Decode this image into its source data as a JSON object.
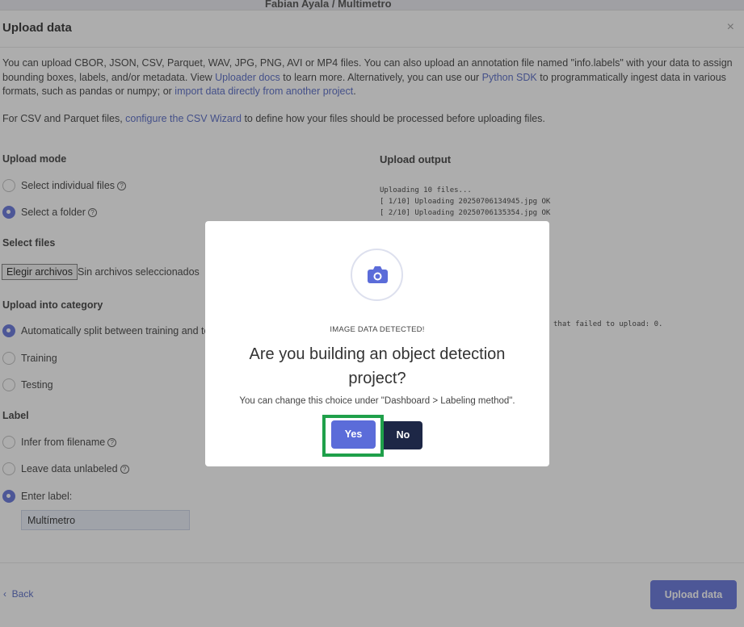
{
  "background_header": {
    "breadcrumb": "Fabian Ayala / Multimetro"
  },
  "dialog": {
    "title": "Upload data",
    "close_glyph": "×",
    "intro": {
      "part1": "You can upload CBOR, JSON, CSV, Parquet, WAV, JPG, PNG, AVI or MP4 files. You can also upload an annotation file named \"info.labels\" with your data to assign bounding boxes, labels, and/or metadata. View ",
      "link1": "Uploader docs",
      "part2": " to learn more. Alternatively, you can use our ",
      "link2": "Python SDK",
      "part3": " to programmatically ingest data in various formats, such as pandas or numpy; or ",
      "link3": "import data directly from another project",
      "part4": "."
    },
    "csv_note": {
      "part1": "For CSV and Parquet files, ",
      "link": "configure the CSV Wizard",
      "part2": " to define how your files should be processed before uploading files."
    },
    "upload_mode": {
      "title": "Upload mode",
      "options": [
        "Select individual files",
        "Select a folder"
      ],
      "selected": 1
    },
    "select_files": {
      "title": "Select files",
      "button": "Elegir archivos",
      "status": "Sin archivos seleccionados"
    },
    "category": {
      "title": "Upload into category",
      "options": [
        "Automatically split between training and te",
        "Training",
        "Testing"
      ],
      "selected": 0
    },
    "label": {
      "title": "Label",
      "options": [
        "Infer from filename",
        "Leave data unlabeled",
        "Enter label:"
      ],
      "selected": 2,
      "value": "Multímetro"
    },
    "output": {
      "title": "Upload output",
      "lines": [
        "Uploading 10 files...",
        "[ 1/10] Uploading 20250706134945.jpg OK",
        "[ 2/10] Uploading 20250706135354.jpg OK"
      ],
      "tail": "that failed to upload: 0."
    },
    "footer": {
      "back": "Back",
      "upload": "Upload data"
    }
  },
  "modal": {
    "icon": "camera-icon",
    "eyebrow": "IMAGE DATA DETECTED!",
    "question": "Are you building an object detection project?",
    "note": "You can change this choice under \"Dashboard > Labeling method\".",
    "yes": "Yes",
    "no": "No"
  },
  "colors": {
    "accent": "#5b6cd9",
    "dark": "#1d2746",
    "highlight": "#1fa04a",
    "link": "#4a5fc1"
  }
}
